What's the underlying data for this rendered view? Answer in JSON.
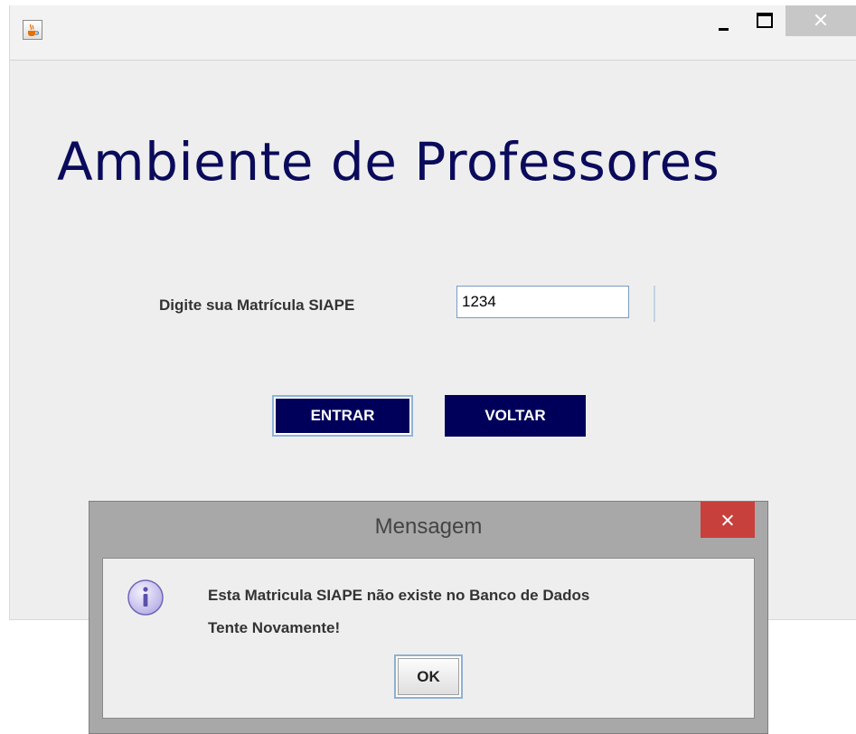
{
  "window": {
    "title": ""
  },
  "main": {
    "heading": "Ambiente de Professores",
    "siape_label": "Digite sua Matrícula SIAPE",
    "siape_value": "1234",
    "enter_label": "ENTRAR",
    "back_label": "VOLTAR"
  },
  "dialog": {
    "title": "Mensagem",
    "message_line1": "Esta Matricula SIAPE não existe no Banco de Dados",
    "message_line2": "Tente Novamente!",
    "ok_label": "OK"
  },
  "icons": {
    "app": "java-cup-icon",
    "minimize": "minimize-icon",
    "maximize": "maximize-icon",
    "close": "close-icon",
    "info": "info-icon"
  },
  "colors": {
    "heading": "#0b0b5c",
    "button_bg": "#00005a",
    "dialog_close": "#c7403c"
  }
}
